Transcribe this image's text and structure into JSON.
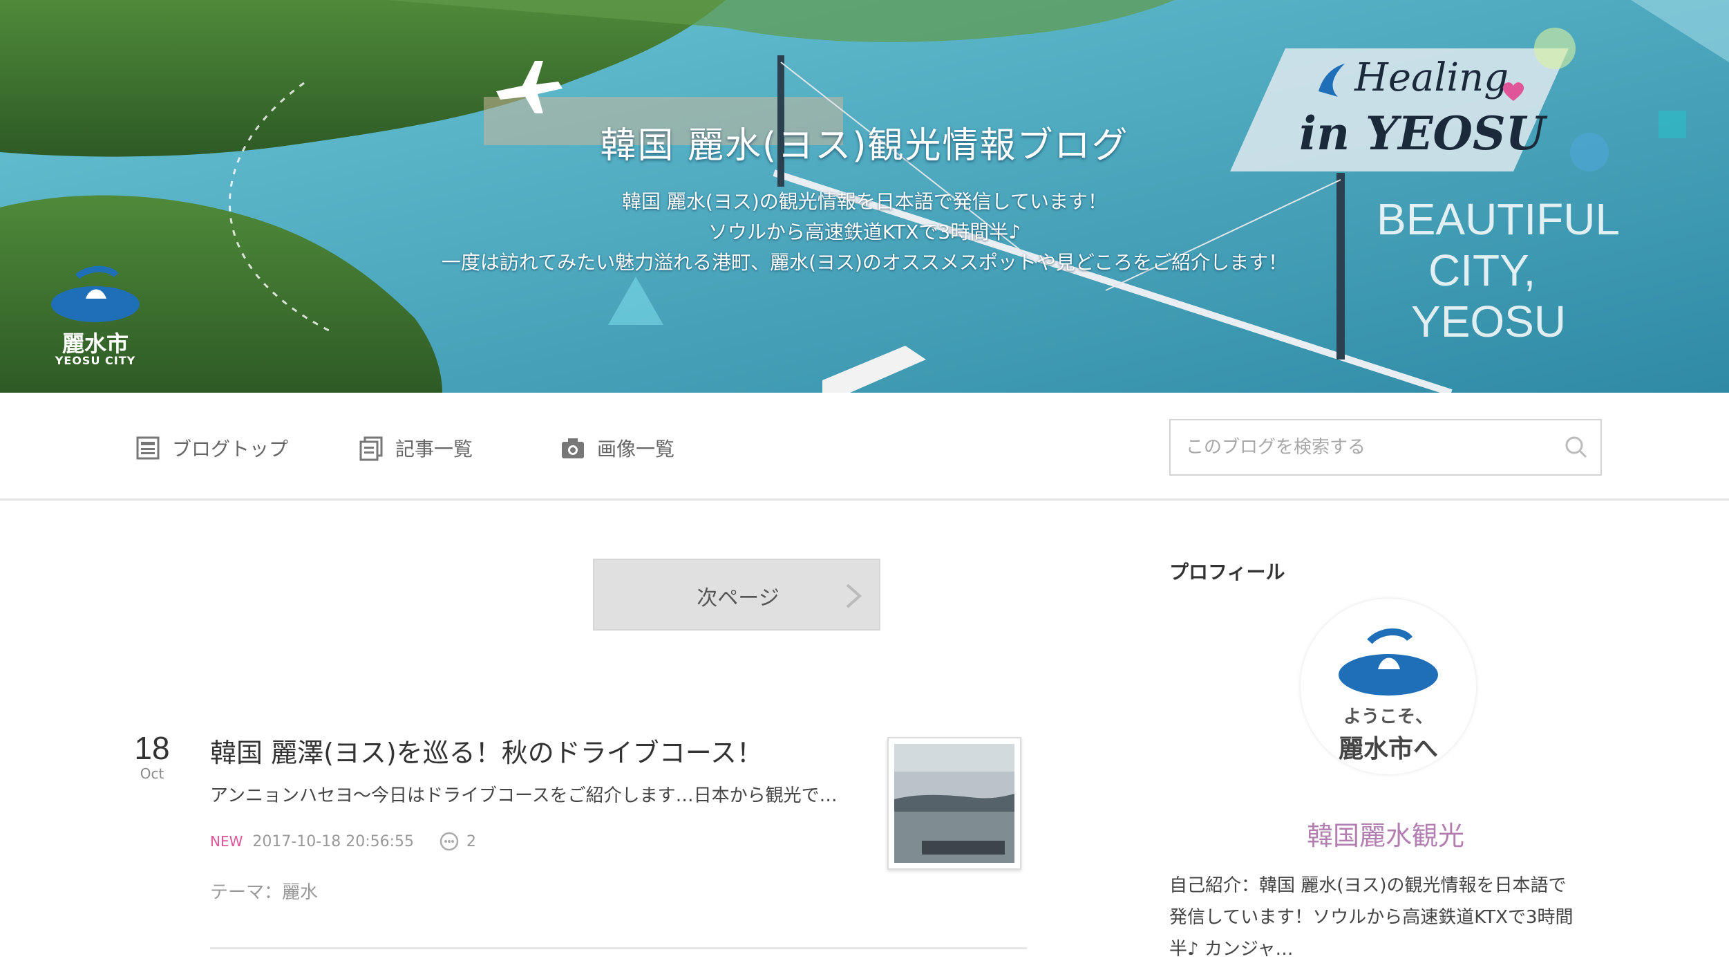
{
  "banner": {
    "title": "韓国 麗水(ヨス)観光情報ブログ",
    "desc_line1": "韓国 麗水(ヨス)の観光情報を日本語で発信しています！",
    "desc_line2": "ソウルから高速鉄道KTXで3時間半♪",
    "desc_line3": "一度は訪れてみたい魅力溢れる港町、麗水(ヨス)のオススメスポットや見どころをご紹介します！",
    "healing_line1": "Healing",
    "healing_line2": "in YEOSU",
    "slogan_line1": "BEAUTIFUL",
    "slogan_line2": "CITY,",
    "slogan_line3": "YEOSU",
    "city_logo_name": "麗水市",
    "city_logo_sub": "YEOSU CITY"
  },
  "nav": {
    "items": [
      {
        "label": "ブログトップ",
        "icon": "blog-top-icon"
      },
      {
        "label": "記事一覧",
        "icon": "article-list-icon"
      },
      {
        "label": "画像一覧",
        "icon": "camera-icon"
      }
    ],
    "search_placeholder": "このブログを検索する"
  },
  "pager": {
    "next_label": "次ページ"
  },
  "post": {
    "day": "18",
    "month": "Oct",
    "title": "韓国 麗澤(ヨス)を巡る！秋のドライブコース！",
    "excerpt": "アンニョンハセヨ～今日はドライブコースをご紹介します…日本から観光で…",
    "new_tag": "NEW",
    "datetime": "2017-10-18 20:56:55",
    "comment_count": "2",
    "theme_label": "テーマ：",
    "theme_value": "麗水"
  },
  "sidebar": {
    "profile_heading": "プロフィール",
    "avatar_line1": "ようこそ、",
    "avatar_line2": "麗水市へ",
    "profile_name": "韓国麗水観光",
    "bio_line1": "自己紹介：韓国 麗水(ヨス)の観光情報を日本語で",
    "bio_line2": "発信しています！ソウルから高速鉄道KTXで3時間",
    "bio_line3": "半♪ カンジャ…"
  },
  "colors": {
    "accent_pink": "#e0559a",
    "profile_name": "#b37fb0",
    "logo_blue": "#1f6fb8",
    "sea": "#3a9cb5"
  }
}
